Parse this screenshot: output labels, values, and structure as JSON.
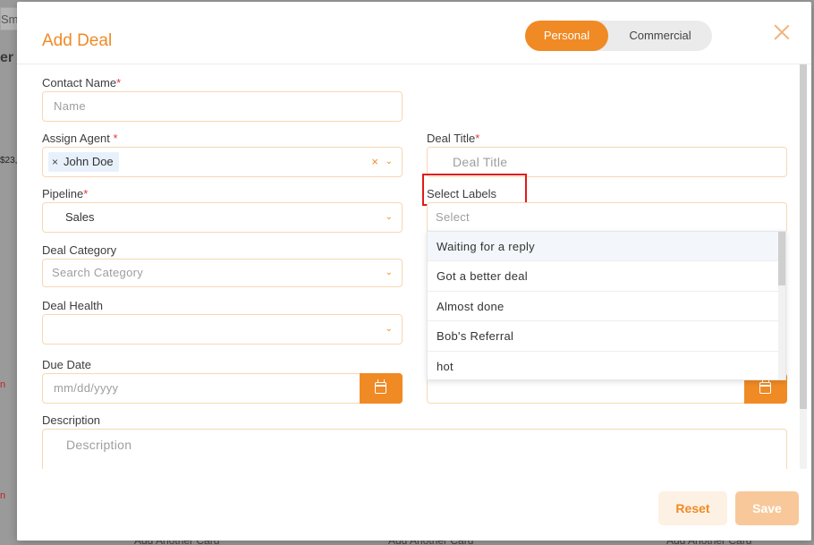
{
  "background": {
    "tab_text": "Sm",
    "header_letter": "er",
    "money_text": "$23,",
    "red_marker": "n",
    "footer_links": [
      "Add Another Card",
      "Add Another Card",
      "Add Another Card"
    ]
  },
  "modal": {
    "title": "Add Deal",
    "toggle": {
      "personal": "Personal",
      "commercial": "Commercial",
      "selected": "Personal"
    },
    "fields": {
      "contact_name": {
        "label": "Contact Name",
        "required": "*",
        "placeholder": "Name"
      },
      "assign_agent": {
        "label": "Assign Agent ",
        "required": "*",
        "tag": "John Doe",
        "tag_remove": "×",
        "clear": "×"
      },
      "deal_title": {
        "label": "Deal Title",
        "required": "*",
        "placeholder": "Deal Title"
      },
      "pipeline": {
        "label": "Pipeline",
        "required": "*",
        "value": "Sales"
      },
      "select_labels": {
        "label": "Select Labels",
        "placeholder": "Select"
      },
      "deal_category": {
        "label": "Deal Category",
        "placeholder": "Search Category"
      },
      "deal_health": {
        "label": "Deal Health",
        "value": ""
      },
      "due_date": {
        "label": "Due Date",
        "placeholder": "mm/dd/yyyy"
      },
      "description": {
        "label": "Description",
        "placeholder": "Description"
      }
    },
    "labels_dropdown": [
      "Waiting for a reply",
      "Got a better deal",
      "Almost done",
      "Bob's Referral",
      "hot"
    ],
    "buttons": {
      "reset": "Reset",
      "save": "Save"
    }
  },
  "colors": {
    "accent": "#f08a24",
    "required": "#e23a3a",
    "highlight": "#e21a1a"
  },
  "icons": {
    "chevron": "chevron-down-icon",
    "calendar": "calendar-icon",
    "close": "close-icon"
  }
}
